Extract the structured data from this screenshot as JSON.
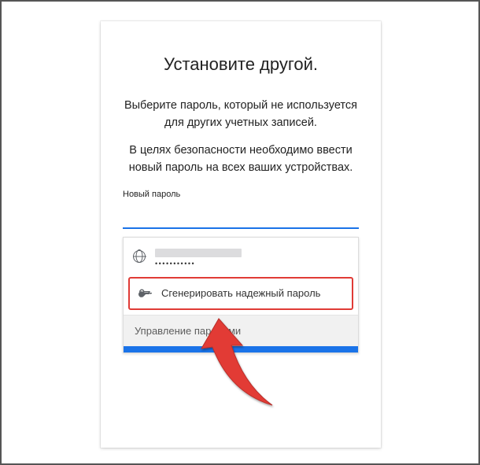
{
  "title": "Установите другой.",
  "description1": "Выберите пароль, который не используется для других учетных записей.",
  "description2": "В целях безопасности необходимо ввести новый пароль на всех ваших устройствах.",
  "fieldLabel": "Новый пароль",
  "account": {
    "maskedPassword": "•••••••••••"
  },
  "generateLabel": "Сгенерировать надежный пароль",
  "manageLabel": "Управление паролями",
  "colors": {
    "accent": "#1a73e8",
    "highlight": "#e03b36"
  }
}
